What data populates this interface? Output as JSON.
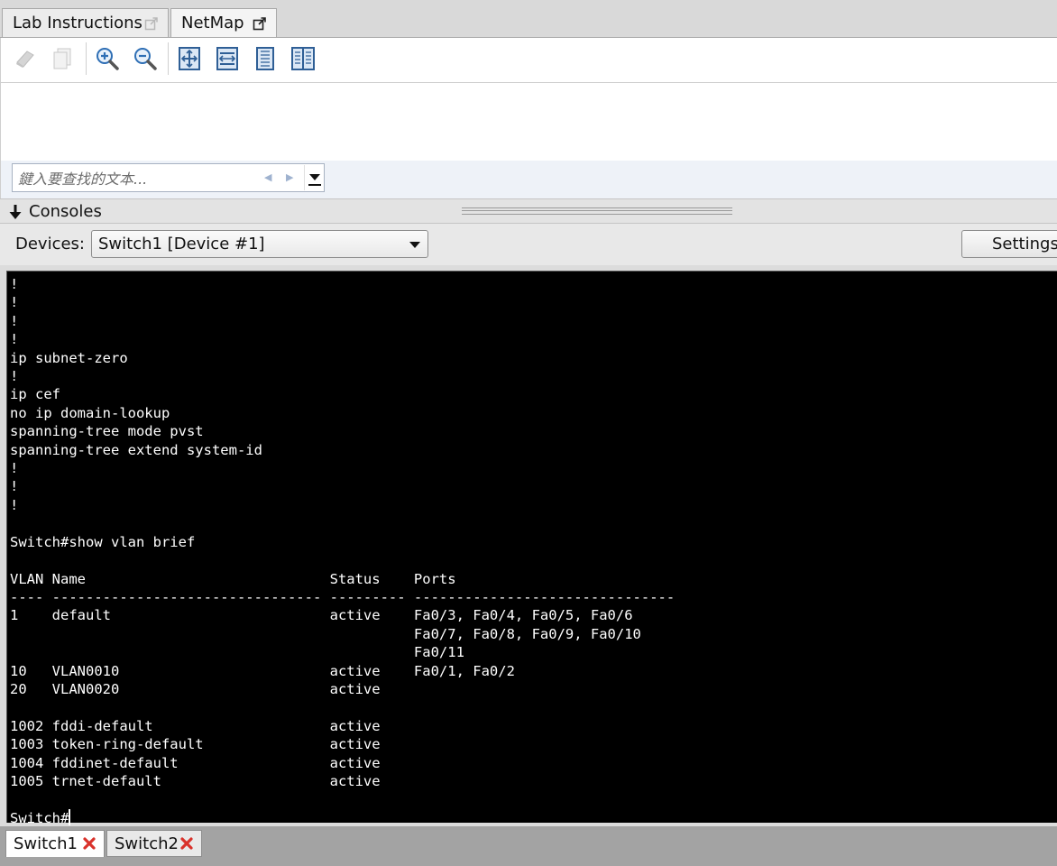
{
  "top_tabs": [
    {
      "label": "Lab Instructions"
    },
    {
      "label": "NetMap"
    }
  ],
  "find": {
    "placeholder": "鍵入要查找的文本..."
  },
  "consoles": {
    "title": "Consoles"
  },
  "devices": {
    "label": "Devices:",
    "selected": "Switch1 [Device #1]",
    "settings_label": "Settings..."
  },
  "terminal": {
    "lines": [
      "!",
      "!",
      "!",
      "!",
      "ip subnet-zero",
      "!",
      "ip cef",
      "no ip domain-lookup",
      "spanning-tree mode pvst",
      "spanning-tree extend system-id",
      "!",
      "!",
      "!",
      "",
      "Switch#show vlan brief",
      "",
      "VLAN Name                             Status    Ports",
      "---- -------------------------------- --------- -------------------------------",
      "1    default                          active    Fa0/3, Fa0/4, Fa0/5, Fa0/6",
      "                                                Fa0/7, Fa0/8, Fa0/9, Fa0/10",
      "                                                Fa0/11",
      "10   VLAN0010                         active    Fa0/1, Fa0/2",
      "20   VLAN0020                         active",
      "",
      "1002 fddi-default                     active",
      "1003 token-ring-default               active",
      "1004 fddinet-default                  active",
      "1005 trnet-default                    active",
      ""
    ],
    "prompt": "Switch#"
  },
  "console_tabs": [
    {
      "label": "Switch1"
    },
    {
      "label": "Switch2"
    }
  ],
  "colors": {
    "terminal_bg": "#000000",
    "terminal_fg": "#ffffff",
    "close_red": "#d9322b",
    "toolbar_icon_blue": "#2f6fb5"
  }
}
